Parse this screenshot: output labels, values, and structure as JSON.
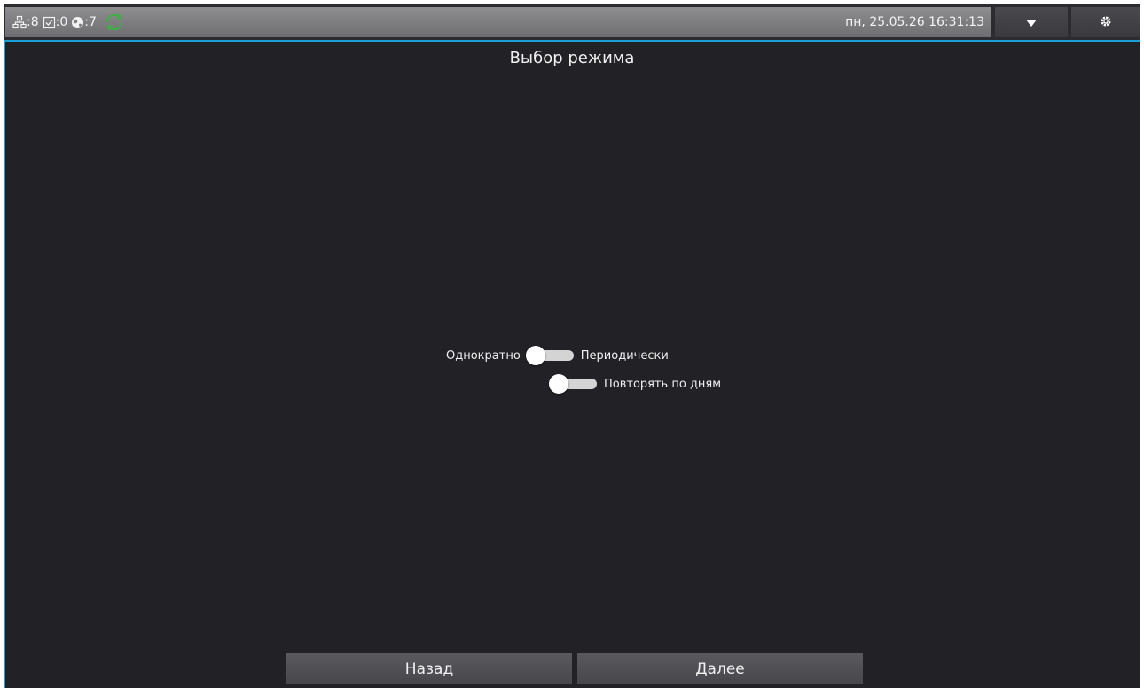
{
  "status_bar": {
    "network_count": ":8",
    "task_count": ":0",
    "globe_count": ":7",
    "datetime": "пн, 25.05.26 16:31:13",
    "icons": {
      "network": "network-icon",
      "task": "checkbox-icon",
      "globe": "globe-icon",
      "sync": "sync-icon",
      "dropdown": "chevron-down-icon",
      "settings": "gear-icon"
    },
    "colors": {
      "accent": "#1aa0d8",
      "sync": "#3cb043"
    }
  },
  "page": {
    "title": "Выбор режима"
  },
  "mode_toggle": {
    "left_label": "Однократно",
    "right_label": "Периодически",
    "state": "off"
  },
  "repeat_toggle": {
    "label": "Повторять по дням",
    "state": "off"
  },
  "footer": {
    "back_label": "Назад",
    "next_label": "Далее"
  }
}
